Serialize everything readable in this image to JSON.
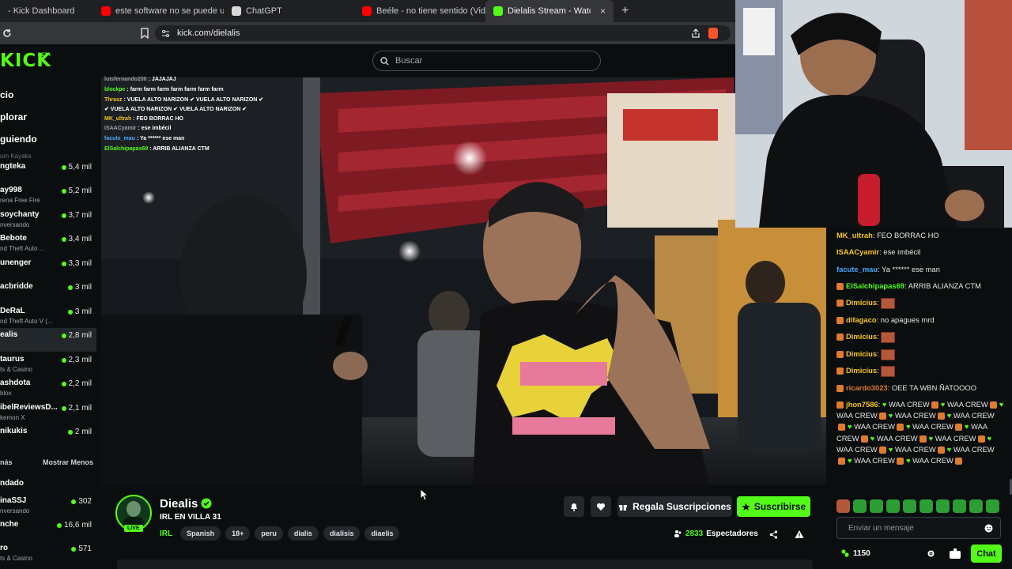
{
  "browser": {
    "tabs": [
      {
        "title": "- Kick Dashboard",
        "favicon": "kick-icon",
        "active": false
      },
      {
        "title": "este software no se puede usar mie",
        "favicon": "youtube-icon",
        "active": false
      },
      {
        "title": "ChatGPT",
        "favicon": "chatgpt-icon",
        "active": false
      },
      {
        "title": "Beéle - no tiene sentido (Video Ofic",
        "favicon": "youtube-icon",
        "active": false
      },
      {
        "title": "Dielalis Stream - Watch Live",
        "favicon": "kick-icon",
        "active": true
      }
    ],
    "new_tab": "+",
    "close_tab": "×",
    "url": "kick.com/dielalis"
  },
  "kick": {
    "logo": "KICK",
    "beta": "BETA",
    "search_placeholder": "Buscar"
  },
  "sidebar": {
    "nav": [
      "cio",
      "plorar",
      "guiendo"
    ],
    "top_fragment": "um Kayaks",
    "channels": [
      {
        "name": "ngteka",
        "sub": "",
        "count": "5,4 mil",
        "active": false
      },
      {
        "name": "ay998",
        "sub": "rena Free Fire",
        "count": "5,2 mil",
        "active": false
      },
      {
        "name": "soychanty",
        "sub": "nversando",
        "count": "3,7 mil",
        "active": false
      },
      {
        "name": "Bebote",
        "sub": "nd Theft Auto ...",
        "count": "3,4 mil",
        "active": false
      },
      {
        "name": "unenger",
        "sub": "",
        "count": "3,3 mil",
        "active": false
      },
      {
        "name": "acbridde",
        "sub": "",
        "count": "3 mil",
        "active": false
      },
      {
        "name": "DeRaL",
        "sub": "nd Theft Auto V (...",
        "count": "3 mil",
        "active": false
      },
      {
        "name": "ealis",
        "sub": "",
        "count": "2,8 mil",
        "active": true
      },
      {
        "name": "taurus",
        "sub": "ts & Casino",
        "count": "2,3 mil",
        "active": false
      },
      {
        "name": "ashdota",
        "sub": "blox",
        "count": "2,2 mil",
        "active": false
      },
      {
        "name": "ibelReviewsD...",
        "sub": "kemon X",
        "count": "2,1 mil",
        "active": false
      },
      {
        "name": "nikukis",
        "sub": "",
        "count": "2 mil",
        "active": false
      }
    ],
    "show_more": "nás",
    "show_less": "Mostrar Menos",
    "recommended": "ndado",
    "recommended_channels": [
      {
        "name": "inaSSJ",
        "sub": "nversando",
        "count": "302"
      },
      {
        "name": "nche",
        "sub": "",
        "count": "16,6 mil"
      },
      {
        "name": "ro",
        "sub": "ts & Casino",
        "count": "571"
      }
    ]
  },
  "video_overlay_chat": [
    {
      "user": "luisfernando200",
      "text": "JAJAJAJ",
      "color": "#a0a4aa"
    },
    {
      "user": "blockpe",
      "text": "farm farm farm farm farm farm farm",
      "color": "#53fc18"
    },
    {
      "user": "Thrasz",
      "text": "VUELA ALTO NARIZON ✔ VUELA ALTO NARIZON ✔",
      "color": "#f3c623"
    },
    {
      "user": "",
      "text": "✔ VUELA ALTO NARIZON ✔ VUELA ALTO NARIZON ✔",
      "color": "#ffffff"
    },
    {
      "user": "MK_ultrah",
      "text": "FEO BORRAC HO",
      "color": "#f3c623"
    },
    {
      "user": "ISAACyamir",
      "text": "ese imbécil",
      "color": "#a0a4aa"
    },
    {
      "user": "facute_mau",
      "text": "Ya ****** ese man",
      "color": "#4aa8ff"
    },
    {
      "user": "ElSalchipapas69",
      "text": "ARRIB ALIANZA CTM",
      "color": "#53fc18"
    }
  ],
  "channel": {
    "name": "Diealis",
    "live_badge": "LIVE",
    "title": "IRL EN VILLA 31",
    "category": "IRL",
    "tags": [
      "Spanish",
      "18+",
      "peru",
      "dialis",
      "dialisis",
      "diaelis"
    ],
    "viewers": "2833",
    "viewers_label": "Espectadores",
    "gift_label": "Regala Suscripciones",
    "subscribe_label": "Suscribirse"
  },
  "chat": {
    "messages": [
      {
        "user": "MK_ultrah",
        "text": "FEO BORRAC HO",
        "color": "#f3c623"
      },
      {
        "user": "ISAACyamir",
        "text": "ese imbécil",
        "color": "#f3c623"
      },
      {
        "user": "facute_mau",
        "text": "Ya ****** ese man",
        "color": "#4aa8ff"
      },
      {
        "user": "ElSalchipapas69",
        "text": "ARRIB ALIANZA CTM",
        "color": "#53fc18"
      },
      {
        "user": "Dimicius",
        "text": "",
        "color": "#f3c623"
      },
      {
        "user": "difagaco",
        "text": "no apagues mrd",
        "color": "#f3c623"
      },
      {
        "user": "Dimicius",
        "text": "",
        "color": "#f3c623"
      },
      {
        "user": "Dimicius",
        "text": "",
        "color": "#f3c623"
      },
      {
        "user": "Dimicius",
        "text": "",
        "color": "#f3c623"
      },
      {
        "user": "ricardo3023",
        "text": "OEE TA WBN ÑATOOOO",
        "color": "#e07a2f"
      }
    ],
    "spam_user": "jhon7586",
    "spam_text": "WAA CREW",
    "input_placeholder": "Enviar un mensaje",
    "points": "1150",
    "send_label": "Chat"
  },
  "colors": {
    "brand": "#53fc18",
    "background": "#0b0e0f"
  }
}
